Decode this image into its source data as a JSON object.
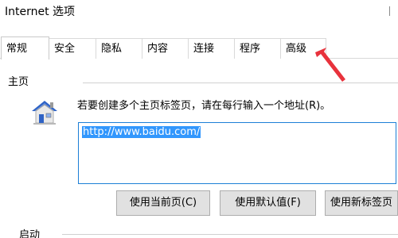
{
  "window": {
    "title": "Internet 选项"
  },
  "tabs": [
    {
      "label": "常规",
      "active": true
    },
    {
      "label": "安全",
      "active": false
    },
    {
      "label": "隐私",
      "active": false
    },
    {
      "label": "内容",
      "active": false
    },
    {
      "label": "连接",
      "active": false
    },
    {
      "label": "程序",
      "active": false
    },
    {
      "label": "高级",
      "active": false
    }
  ],
  "home": {
    "section_label": "主页",
    "icon": "home-icon",
    "instruction": "若要创建多个主页标签页，请在每行输入一个地址(R)。",
    "url_value": "http://www.baidu.com/",
    "buttons": {
      "use_current": "使用当前页(C)",
      "use_default": "使用默认值(F)",
      "use_new_tab": "使用新标签页"
    }
  },
  "startup": {
    "section_label": "启动"
  },
  "annotation": {
    "arrow_color": "#e8323c",
    "arrow_target": "tab-advanced"
  },
  "colors": {
    "accent_border": "#1c7fd6",
    "selection": "#3297fd",
    "button_bg": "#e1e1e1"
  }
}
